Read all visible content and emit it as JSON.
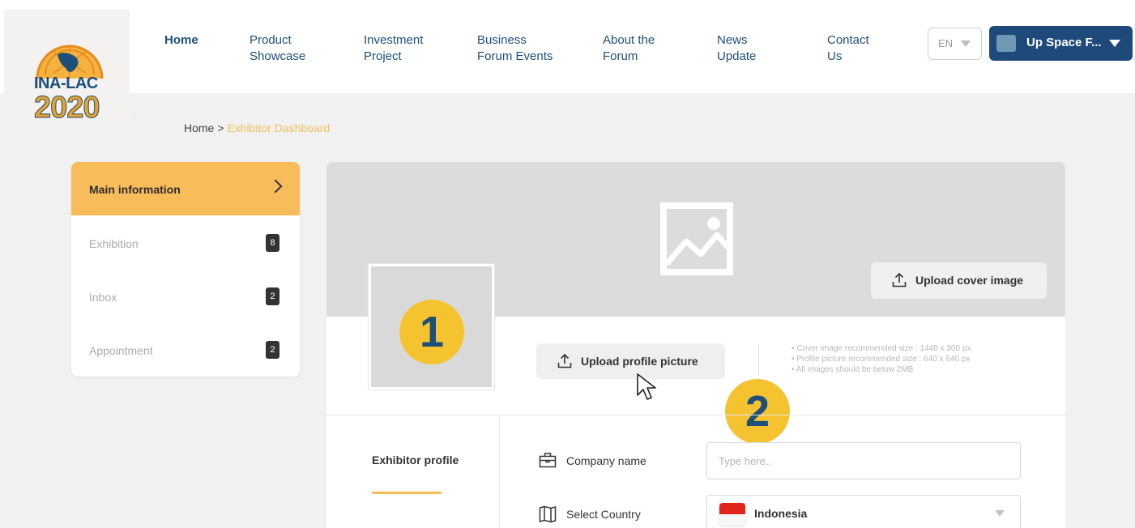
{
  "logo": {
    "line1": "INA-LAC",
    "line2": "2020"
  },
  "nav": {
    "home": {
      "line1": "Home",
      "line2": ""
    },
    "product": {
      "line1": "Product",
      "line2": "Showcase"
    },
    "investment": {
      "line1": "Investment",
      "line2": "Project"
    },
    "business": {
      "line1": "Business",
      "line2": "Forum Events"
    },
    "about": {
      "line1": "About the",
      "line2": "Forum"
    },
    "news": {
      "line1": "News",
      "line2": "Update"
    },
    "contact": {
      "line1": "Contact",
      "line2": "Us"
    }
  },
  "language": {
    "value": "EN"
  },
  "user": {
    "name": "Up Space F..."
  },
  "breadcrumb": {
    "home": "Home",
    "separator": " > ",
    "current": "Exhibitor Dashboard"
  },
  "sidebar": {
    "items": [
      {
        "label": "Main information",
        "badge": ""
      },
      {
        "label": "Exhibition",
        "badge": "8"
      },
      {
        "label": "Inbox",
        "badge": "2"
      },
      {
        "label": "Appointment",
        "badge": "2"
      }
    ]
  },
  "cover": {
    "upload_label": "Upload cover image"
  },
  "profile": {
    "upload_label": "Upload profile picture"
  },
  "markers": {
    "one": "1",
    "two": "2"
  },
  "notes": [
    "• Cover image recommended size : 1440 x 300 px",
    "• Profile picture recommended size : 640 x 640 px",
    "• All images should be below 2MB"
  ],
  "tabs": {
    "exhibitor_profile": "Exhibitor profile"
  },
  "form": {
    "company_label": "Company name",
    "company_placeholder": "Type here..",
    "country_label": "Select Country",
    "country_value": "Indonesia"
  },
  "colors": {
    "primary": "#1d4a7a",
    "accent": "#f8bc5a",
    "marker": "#f5c330",
    "breadcrumb_current": "#f2c15c"
  },
  "icons": {
    "upload": "upload-icon",
    "image_placeholder": "image-placeholder-icon",
    "briefcase": "briefcase-icon",
    "country": "map-icon",
    "cursor": "cursor-icon"
  }
}
